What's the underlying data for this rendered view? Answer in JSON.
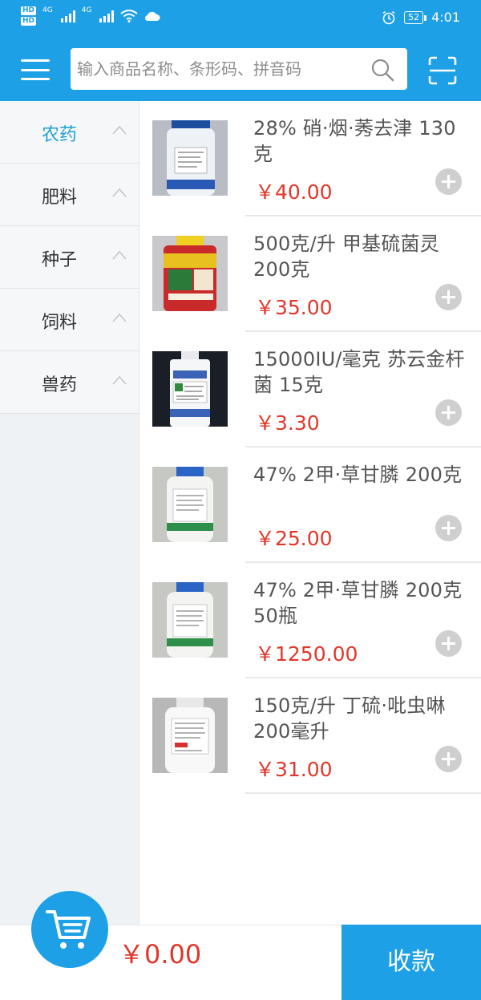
{
  "status_bar": {
    "left_tags": [
      "HD",
      "HD"
    ],
    "network": [
      "4G",
      "4G"
    ],
    "battery": "52",
    "time": "4:01"
  },
  "search": {
    "placeholder": "输入商品名称、条形码、拼音码"
  },
  "categories": [
    {
      "label": "农药",
      "active": true
    },
    {
      "label": "肥料",
      "active": false
    },
    {
      "label": "种子",
      "active": false
    },
    {
      "label": "饲料",
      "active": false
    },
    {
      "label": "兽药",
      "active": false
    }
  ],
  "products": [
    {
      "name": "28% 硝·烟·莠去津 130克",
      "price": "￥40.00"
    },
    {
      "name": "500克/升 甲基硫菌灵 200克",
      "price": "￥35.00"
    },
    {
      "name": "15000IU/毫克 苏云金杆菌 15克",
      "price": "￥3.30"
    },
    {
      "name": "47% 2甲·草甘膦 200克",
      "price": "￥25.00"
    },
    {
      "name": "47% 2甲·草甘膦 200克  50瓶",
      "price": "￥1250.00"
    },
    {
      "name": "150克/升 丁硫·吡虫啉 200毫升",
      "price": "￥31.00"
    }
  ],
  "cart": {
    "total": "￥0.00"
  },
  "checkout": {
    "label": "收款"
  },
  "colors": {
    "primary": "#1ea0e6",
    "price": "#e1372a"
  }
}
